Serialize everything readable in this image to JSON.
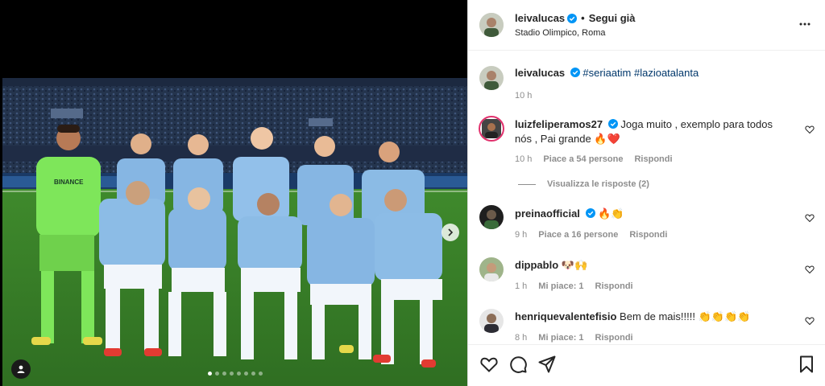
{
  "post": {
    "author": "leivalucas",
    "follow_status": "Segui già",
    "separator": "•",
    "location": "Stadio Olimpico, Roma",
    "caption_author": "leivalucas",
    "caption_text": "#seriaatim #lazioatalanta",
    "caption_time": "10 h"
  },
  "media": {
    "carousel_count": 8,
    "active_index": 0,
    "next_icon": "chevron-right-icon",
    "tag_icon": "person-tag-icon",
    "shirt_sponsor": "BINANCE"
  },
  "comments": [
    {
      "author": "luizfeliperamos27",
      "verified": true,
      "text": "Joga muito , exemplo para todos nós , Pai grande 🔥❤️",
      "time": "10 h",
      "likes": "Piace a 54 persone",
      "reply": "Rispondi",
      "view_replies": "Visualizza le risposte (2)"
    },
    {
      "author": "preinaofficial",
      "verified": true,
      "text": "🔥👏",
      "time": "9 h",
      "likes": "Piace a 16 persone",
      "reply": "Rispondi"
    },
    {
      "author": "dippablo",
      "verified": false,
      "text": "🐶🙌",
      "time": "1 h",
      "likes": "Mi piace: 1",
      "reply": "Rispondi"
    },
    {
      "author": "henriquevalentefisio",
      "verified": false,
      "text": "Bem de mais!!!!! 👏👏👏👏",
      "time": "8 h",
      "likes": "Mi piace: 1",
      "reply": "Rispondi"
    }
  ],
  "actions": {
    "like_icon": "heart-icon",
    "comment_icon": "comment-icon",
    "share_icon": "send-icon",
    "save_icon": "bookmark-icon"
  },
  "colors": {
    "verified": "#0095f6",
    "link": "#00376b",
    "muted": "#8e8e8e",
    "pitch": "#3b7a2a",
    "kit": "#86b6e3",
    "goalkeeper_kit": "#7ee65a"
  }
}
